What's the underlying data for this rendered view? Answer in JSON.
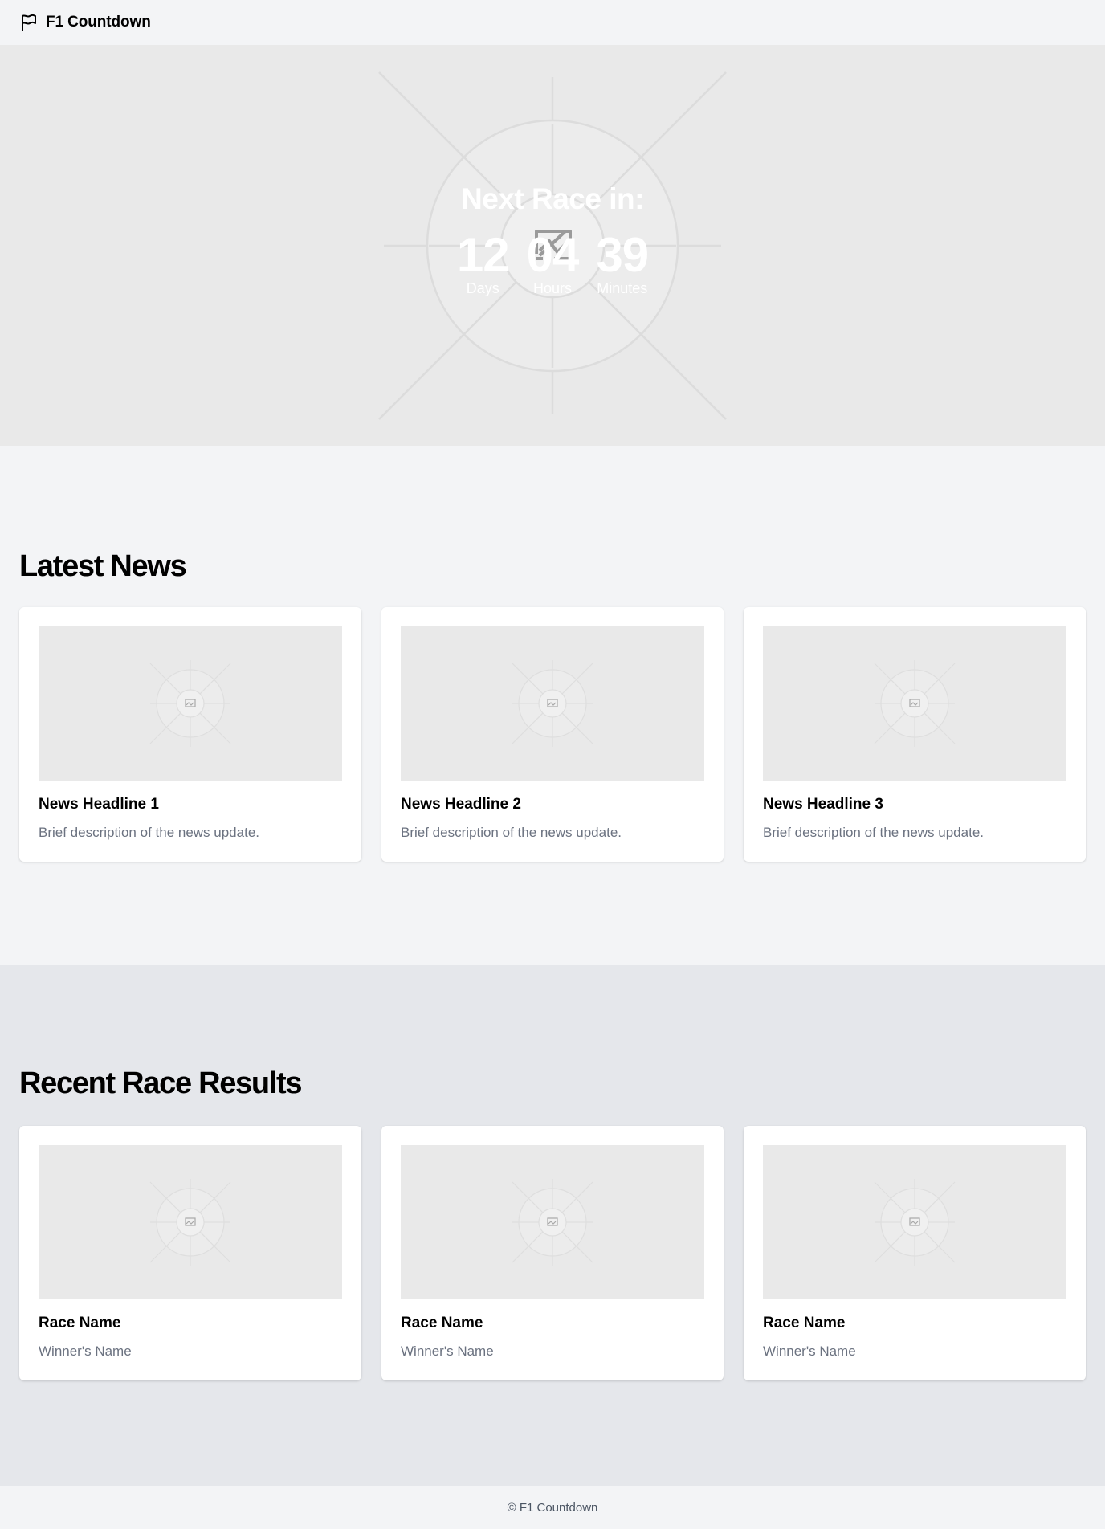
{
  "header": {
    "brand_icon": "flag-icon",
    "brand_name": "F1 Countdown"
  },
  "hero": {
    "title": "Next Race in:",
    "image_icon": "broken-image-icon",
    "countdown": [
      {
        "value": "12",
        "label": "Days"
      },
      {
        "value": "04",
        "label": "Hours"
      },
      {
        "value": "39",
        "label": "Minutes"
      }
    ]
  },
  "news": {
    "title": "Latest News",
    "items": [
      {
        "headline": "News Headline 1",
        "description": "Brief description of the news update."
      },
      {
        "headline": "News Headline 2",
        "description": "Brief description of the news update."
      },
      {
        "headline": "News Headline 3",
        "description": "Brief description of the news update."
      }
    ]
  },
  "results": {
    "title": "Recent Race Results",
    "items": [
      {
        "race": "Race Name",
        "winner": "Winner's Name"
      },
      {
        "race": "Race Name",
        "winner": "Winner's Name"
      },
      {
        "race": "Race Name",
        "winner": "Winner's Name"
      }
    ]
  },
  "footer": {
    "text": "© F1 Countdown"
  },
  "colors": {
    "page_bg": "#f3f4f6",
    "results_bg": "#e5e7eb",
    "placeholder_bg": "#e9e9e9",
    "muted_text": "#6b7280"
  }
}
